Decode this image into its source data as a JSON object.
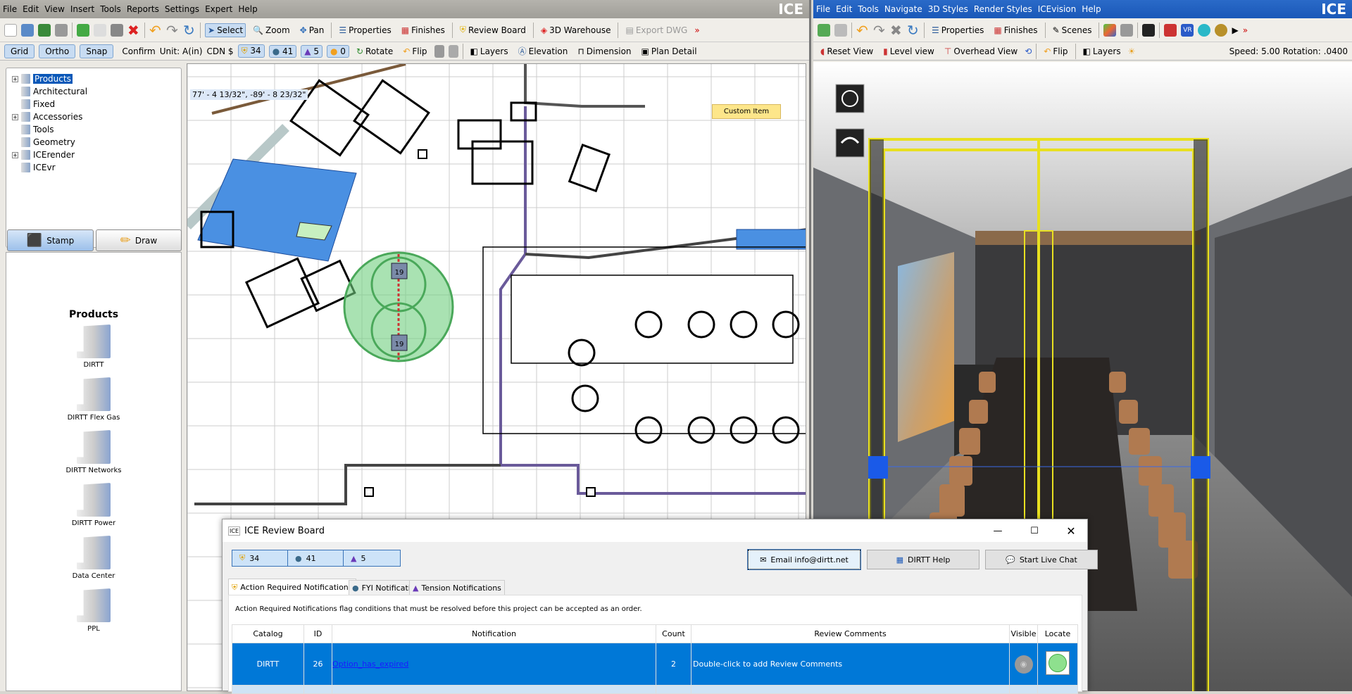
{
  "left_app": {
    "brand": "ICE",
    "menu": [
      "File",
      "Edit",
      "View",
      "Insert",
      "Tools",
      "Reports",
      "Settings",
      "Expert",
      "Help"
    ],
    "toolbar": {
      "select": "Select",
      "zoom": "Zoom",
      "pan": "Pan",
      "properties": "Properties",
      "finishes": "Finishes",
      "review_board": "Review Board",
      "warehouse": "3D Warehouse",
      "export": "Export DWG"
    },
    "toolbar2": {
      "grid": "Grid",
      "ortho": "Ortho",
      "snap": "Snap",
      "confirm": "Confirm",
      "unit": "Unit: A(in)",
      "currency": "CDN $",
      "action_count": "34",
      "fyi_count": "41",
      "tension_count": "5",
      "other_count": "0",
      "rotate": "Rotate",
      "flip": "Flip",
      "layers": "Layers",
      "elevation": "Elevation",
      "dimension": "Dimension",
      "plan_detail": "Plan Detail"
    },
    "tree": [
      {
        "label": "Products",
        "expandable": true,
        "selected": true
      },
      {
        "label": "Architectural",
        "expandable": false
      },
      {
        "label": "Fixed",
        "expandable": false
      },
      {
        "label": "Accessories",
        "expandable": true
      },
      {
        "label": "Tools",
        "expandable": false
      },
      {
        "label": "Geometry",
        "expandable": false
      },
      {
        "label": "ICErender",
        "expandable": true
      },
      {
        "label": "ICEvr",
        "expandable": false
      }
    ],
    "stamp": "Stamp",
    "draw": "Draw",
    "products_title": "Products",
    "products": [
      "DIRTT",
      "DIRTT Flex Gas",
      "DIRTT Networks",
      "DIRTT Power",
      "Data Center",
      "PPL"
    ],
    "canvas": {
      "coordinates": "77' - 4 13/32\", -89' - 8 23/32\"",
      "custom_item": "Custom Item",
      "tag": "19"
    }
  },
  "right_app": {
    "brand": "ICE",
    "menu": [
      "File",
      "Edit",
      "Tools",
      "Navigate",
      "3D Styles",
      "Render Styles",
      "ICEvision",
      "Help"
    ],
    "toolbar": {
      "properties": "Properties",
      "finishes": "Finishes",
      "scenes": "Scenes"
    },
    "toolbar2": {
      "reset": "Reset View",
      "level": "Level view",
      "overhead": "Overhead View",
      "flip": "Flip",
      "layers": "Layers",
      "speed": "Speed: 5.00 Rotation: .0400"
    }
  },
  "review_board": {
    "title": "ICE Review Board",
    "counts": [
      "34",
      "41",
      "5"
    ],
    "email": "Email info@dirtt.net",
    "help": "DIRTT Help",
    "chat": "Start Live Chat",
    "tabs": [
      "Action Required Notifications",
      "FYI Notifications",
      "Tension Notifications"
    ],
    "description": "Action Required Notifications flag conditions that must be resolved before this project can be accepted as an order.",
    "columns": [
      "Catalog",
      "ID",
      "Notification",
      "Count",
      "Review Comments",
      "Visible",
      "Locate"
    ],
    "rows": [
      {
        "catalog": "DIRTT",
        "id": "26",
        "notification": "Option_has_expired",
        "count": "2",
        "comments": "Double-click to add Review Comments"
      }
    ]
  },
  "colors": {
    "selection": "#0078d7",
    "accent_blue": "#1a63c6",
    "green_zone": "#6fcf7f",
    "panel_blue": "#4a90e2"
  }
}
